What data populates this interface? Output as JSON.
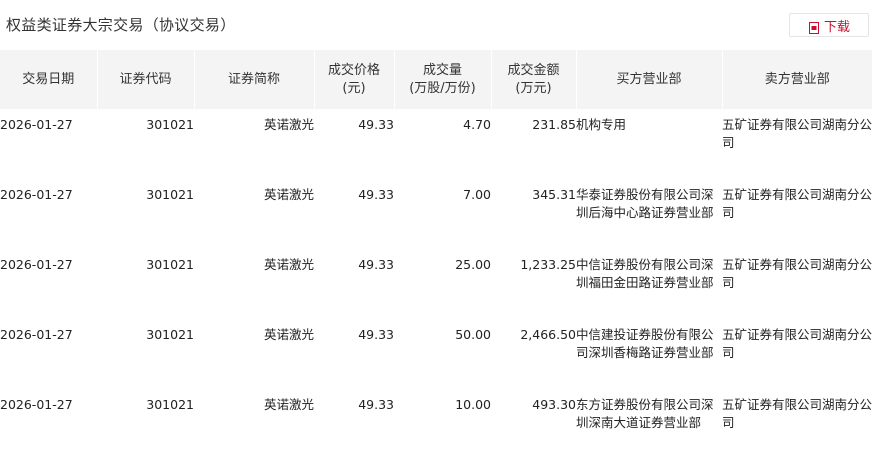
{
  "header": {
    "title": "权益类证券大宗交易（协议交易）",
    "download_label": "下载",
    "download_icon": "pdf-download-icon",
    "accent_color": "#c8102e"
  },
  "table": {
    "columns": [
      {
        "key": "date",
        "label": "交易日期",
        "label2": ""
      },
      {
        "key": "code",
        "label": "证券代码",
        "label2": ""
      },
      {
        "key": "name",
        "label": "证券简称",
        "label2": ""
      },
      {
        "key": "price",
        "label": "成交价格",
        "label2": "(元)"
      },
      {
        "key": "volume",
        "label": "成交量",
        "label2": "(万股/万份)"
      },
      {
        "key": "amount",
        "label": "成交金额",
        "label2": "(万元)"
      },
      {
        "key": "buyer",
        "label": "买方营业部",
        "label2": ""
      },
      {
        "key": "seller",
        "label": "卖方营业部",
        "label2": ""
      }
    ],
    "rows": [
      {
        "date": "2026-01-27",
        "code": "301021",
        "name": "英诺激光",
        "price": "49.33",
        "volume": "4.70",
        "amount": "231.85",
        "buyer": "机构专用",
        "seller": "五矿证券有限公司湖南分公司"
      },
      {
        "date": "2026-01-27",
        "code": "301021",
        "name": "英诺激光",
        "price": "49.33",
        "volume": "7.00",
        "amount": "345.31",
        "buyer": "华泰证券股份有限公司深圳后海中心路证券营业部",
        "seller": "五矿证券有限公司湖南分公司"
      },
      {
        "date": "2026-01-27",
        "code": "301021",
        "name": "英诺激光",
        "price": "49.33",
        "volume": "25.00",
        "amount": "1,233.25",
        "buyer": "中信证券股份有限公司深圳福田金田路证券营业部",
        "seller": "五矿证券有限公司湖南分公司"
      },
      {
        "date": "2026-01-27",
        "code": "301021",
        "name": "英诺激光",
        "price": "49.33",
        "volume": "50.00",
        "amount": "2,466.50",
        "buyer": "中信建投证券股份有限公司深圳香梅路证券营业部",
        "seller": "五矿证券有限公司湖南分公司"
      },
      {
        "date": "2026-01-27",
        "code": "301021",
        "name": "英诺激光",
        "price": "49.33",
        "volume": "10.00",
        "amount": "493.30",
        "buyer": "东方证券股份有限公司深圳深南大道证券营业部",
        "seller": "五矿证券有限公司湖南分公司"
      }
    ]
  }
}
